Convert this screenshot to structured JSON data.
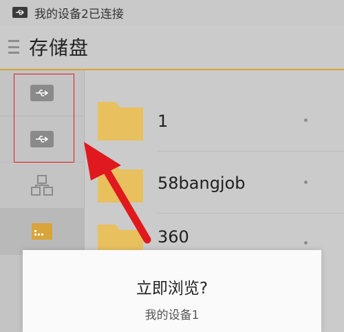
{
  "status_bar": {
    "icon": "usb-icon",
    "text": "我的设备2已连接"
  },
  "header": {
    "menu_icon": "menu-icon",
    "title": "存储盘"
  },
  "sidebar": {
    "items": [
      {
        "icon": "usb-icon"
      },
      {
        "icon": "usb-icon"
      },
      {
        "icon": "network-icon"
      },
      {
        "icon": "sd-card-icon"
      }
    ]
  },
  "files": [
    {
      "name": "1",
      "icon": "folder-icon"
    },
    {
      "name": "58bangjob",
      "icon": "folder-icon"
    },
    {
      "name": "360",
      "icon": "folder-icon"
    }
  ],
  "colors": {
    "accent": "#d4a62a",
    "folder": "#e8c05e",
    "annotation": "#e0191e"
  },
  "dialog": {
    "title": "立即浏览?",
    "subtitle": "我的设备1"
  }
}
